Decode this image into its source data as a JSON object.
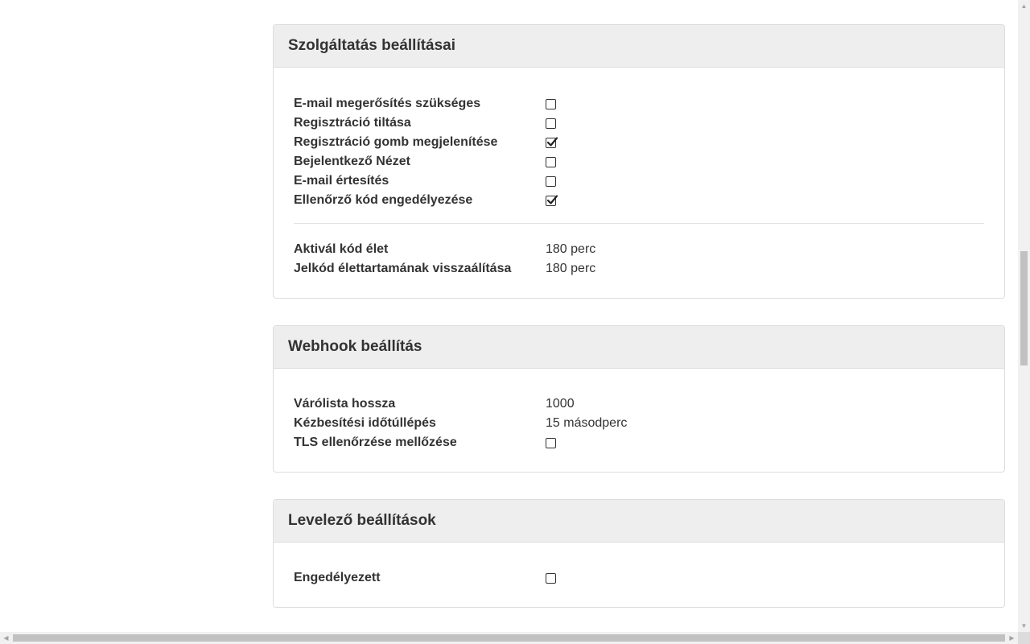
{
  "service_settings": {
    "title": "Szolgáltatás beállításai",
    "toggles": [
      {
        "label": "E-mail megerősítés szükséges",
        "checked": false
      },
      {
        "label": "Regisztráció tiltása",
        "checked": false
      },
      {
        "label": "Regisztráció gomb megjelenítése",
        "checked": true
      },
      {
        "label": "Bejelentkező Nézet",
        "checked": false
      },
      {
        "label": "E-mail értesítés",
        "checked": false
      },
      {
        "label": "Ellenőrző kód engedélyezése",
        "checked": true
      }
    ],
    "values": [
      {
        "label": "Aktivál kód élet",
        "value": "180 perc"
      },
      {
        "label": "Jelkód élettartamának visszaálítása",
        "value": "180 perc"
      }
    ]
  },
  "webhook_settings": {
    "title": "Webhook beállítás",
    "queue_length": {
      "label": "Várólista hossza",
      "value": "1000"
    },
    "delivery_timeout": {
      "label": "Kézbesítési időtúllépés",
      "value": "15 másodperc"
    },
    "skip_tls": {
      "label": "TLS ellenőrzése mellőzése",
      "checked": false
    }
  },
  "mailer_settings": {
    "title": "Levelező beállítások",
    "enabled": {
      "label": "Engedélyezett",
      "checked": false
    }
  },
  "scrollbars": {
    "up_arrow": "▲",
    "down_arrow": "▼",
    "left_arrow": "◀",
    "right_arrow": "▶"
  }
}
